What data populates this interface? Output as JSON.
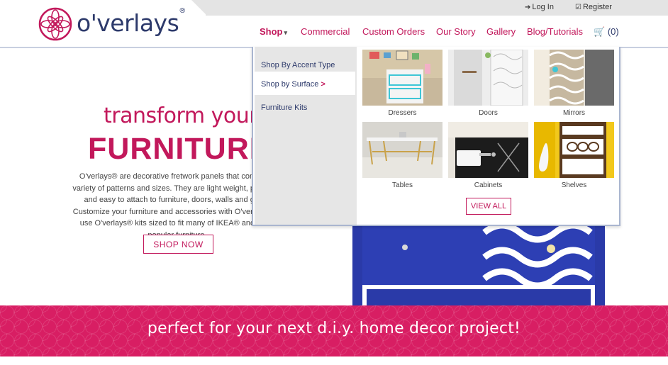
{
  "header": {
    "logo_text": "o'verlays",
    "logo_mark": "®",
    "util": {
      "login": "Log In",
      "register": "Register"
    },
    "nav": {
      "shop": "Shop",
      "commercial": "Commercial",
      "custom_orders": "Custom Orders",
      "our_story": "Our Story",
      "gallery": "Gallery",
      "blog": "Blog/Tutorials",
      "cart_count": "(0)"
    }
  },
  "mega_menu": {
    "side_items": [
      "Shop By Accent Type",
      "Shop by Surface",
      "Furniture Kits"
    ],
    "active_arrow": ">",
    "tiles": [
      "Dressers",
      "Doors",
      "Mirrors",
      "Tables",
      "Cabinets",
      "Shelves"
    ],
    "view_all": "VIEW ALL"
  },
  "hero": {
    "subtitle": "transform your",
    "title": "FURNITURE",
    "body": "O'verlays® are decorative fretwork panels that come in a variety of patterns and sizes. They are light weight, paintable and easy to attach to furniture, doors, walls and glass. Customize your furniture and accessories with O'verlays® or use O'verlays® kits sized to fit many of IKEA® and other popular furniture.",
    "cta": "SHOP NOW"
  },
  "banner": {
    "text": "perfect for your next d.i.y. home decor project!"
  },
  "colors": {
    "brand_pink": "#c2185b",
    "navy": "#2d3a6b",
    "banner": "#d81e63",
    "menu_border": "#a9b5cf"
  },
  "icons": [
    "logo-mandala-icon",
    "login-arrow-icon",
    "register-check-icon",
    "chevron-down-icon",
    "cart-icon",
    "chevron-right-icon"
  ]
}
